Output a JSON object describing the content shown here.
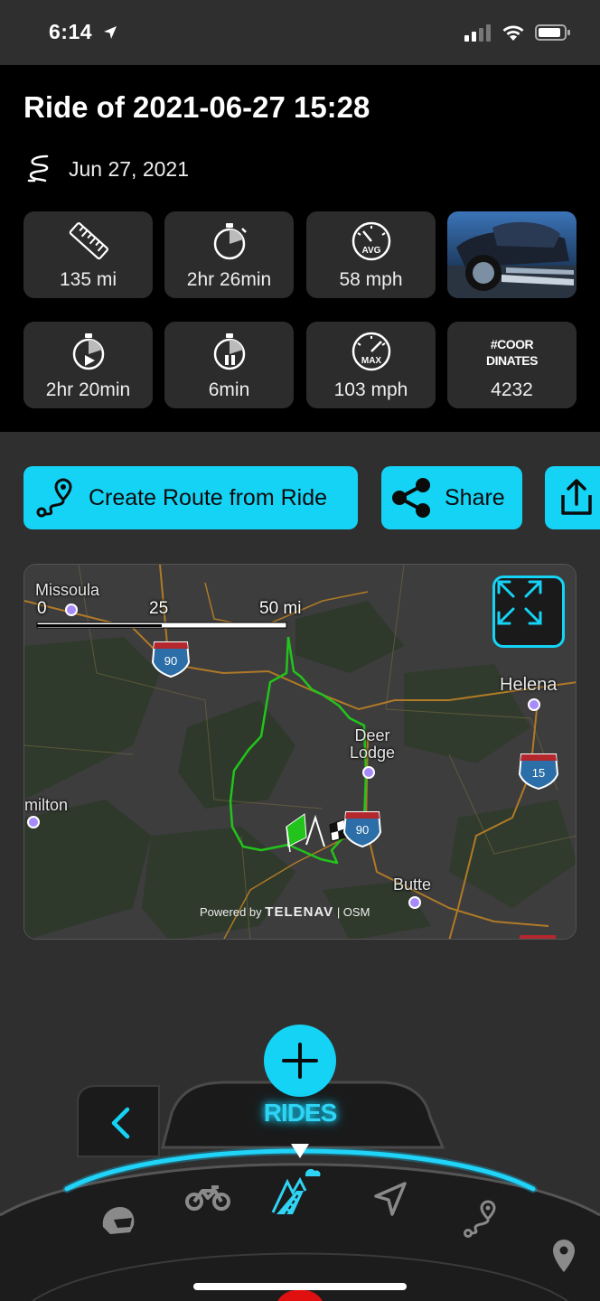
{
  "status_bar": {
    "time": "6:14"
  },
  "ride": {
    "title": "Ride of 2021-06-27 15:28",
    "date": "Jun 27, 2021",
    "stats": {
      "distance": "135 mi",
      "total_time": "2hr 26min",
      "avg_speed": "58 mph",
      "moving_time": "2hr 20min",
      "paused_time": "6min",
      "max_speed": "103 mph",
      "coordinates_title_line1": "#COOR",
      "coordinates_title_line2": "DINATES",
      "coordinates_count": "4232",
      "avg_badge": "AVG",
      "max_badge": "MAX"
    }
  },
  "actions": {
    "create_route_label": "Create Route from Ride",
    "share_label": "Share"
  },
  "map": {
    "cities": {
      "missoula": "Missoula",
      "helena": "Helena",
      "deer_lodge_line1": "Deer",
      "deer_lodge_line2": "Lodge",
      "hamilton": "milton",
      "butte": "Butte"
    },
    "highways": {
      "i90_north": "90",
      "i15": "15",
      "i90_south": "90"
    },
    "scale": {
      "zero": "0",
      "mid": "25",
      "end": "50 mi"
    },
    "powered_by_prefix": "Powered by",
    "powered_by_brand": "TELENAV",
    "powered_by_suffix": "| OSM",
    "route_color": "#22c41c",
    "accent_color": "#15d3f5"
  },
  "bottom_nav": {
    "active_label": "RIDES",
    "items": [
      "helmet-icon",
      "motorcycle-icon",
      "rides-icon",
      "navigate-icon",
      "routes-icon",
      "location-pin-icon"
    ]
  }
}
